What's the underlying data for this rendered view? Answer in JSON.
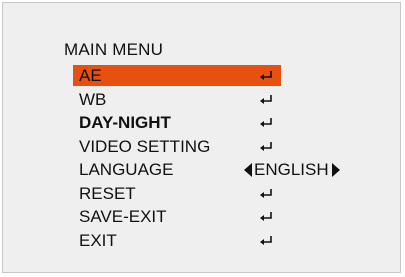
{
  "menu": {
    "title": "MAIN MENU",
    "selected_index": 0,
    "items": [
      {
        "label": "AE",
        "control": "enter-icon"
      },
      {
        "label": "WB",
        "control": "enter-icon"
      },
      {
        "label": "DAY-NIGHT",
        "control": "enter-icon"
      },
      {
        "label": "VIDEO SETTING",
        "control": "enter-icon"
      },
      {
        "label": "LANGUAGE",
        "value": "ENGLISH",
        "control": "left-right-arrows"
      },
      {
        "label": "RESET",
        "control": "enter-icon"
      },
      {
        "label": "SAVE-EXIT",
        "control": "enter-icon"
      },
      {
        "label": "EXIT",
        "control": "enter-icon"
      }
    ]
  },
  "colors": {
    "panel_background": "#efefef",
    "highlight": "#e8500f",
    "text": "#111111"
  }
}
